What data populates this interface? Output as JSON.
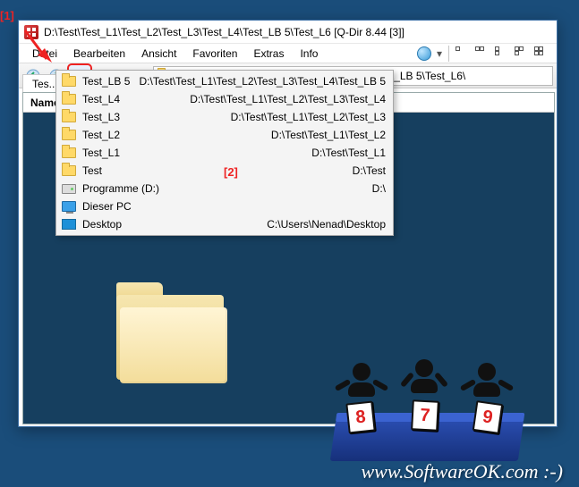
{
  "window": {
    "title": "D:\\Test\\Test_L1\\Test_L2\\Test_L3\\Test_L4\\Test_LB 5\\Test_L6  [Q-Dir 8.44 [3]]"
  },
  "menu": {
    "items": [
      "Datei",
      "Bearbeiten",
      "Ansicht",
      "Favoriten",
      "Extras",
      "Info"
    ]
  },
  "address": {
    "path": "D:\\Test\\Test_L1\\Test_L2\\Test_L3\\Test_L4\\Test_LB 5\\Test_L6\\"
  },
  "tab": {
    "label": "Tes..."
  },
  "columns": {
    "name": "Name"
  },
  "dropdown": {
    "items": [
      {
        "icon": "folder",
        "name": "Test_LB 5",
        "path": "D:\\Test\\Test_L1\\Test_L2\\Test_L3\\Test_L4\\Test_LB 5"
      },
      {
        "icon": "folder",
        "name": "Test_L4",
        "path": "D:\\Test\\Test_L1\\Test_L2\\Test_L3\\Test_L4"
      },
      {
        "icon": "folder",
        "name": "Test_L3",
        "path": "D:\\Test\\Test_L1\\Test_L2\\Test_L3"
      },
      {
        "icon": "folder",
        "name": "Test_L2",
        "path": "D:\\Test\\Test_L1\\Test_L2"
      },
      {
        "icon": "folder",
        "name": "Test_L1",
        "path": "D:\\Test\\Test_L1"
      },
      {
        "icon": "folder",
        "name": "Test",
        "path": "D:\\Test"
      },
      {
        "icon": "drive",
        "name": "Programme (D:)",
        "path": "D:\\"
      },
      {
        "icon": "pc",
        "name": "Dieser PC",
        "path": ""
      },
      {
        "icon": "desktop",
        "name": "Desktop",
        "path": "C:\\Users\\Nenad\\Desktop"
      }
    ]
  },
  "annotations": {
    "a1": "[1]",
    "a2": "[2]"
  },
  "judges": {
    "scores": [
      "8",
      "7",
      "9"
    ]
  },
  "watermark": "www.SoftwareOK.com :-)"
}
